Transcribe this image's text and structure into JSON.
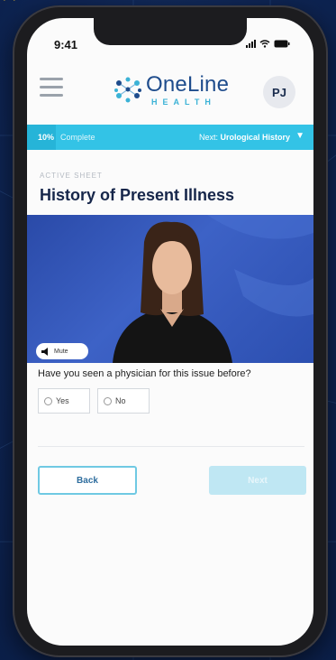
{
  "status_bar": {
    "time": "9:41"
  },
  "header": {
    "logo_name": "OneLine",
    "logo_sub": "HEALTH",
    "avatar_initials": "PJ"
  },
  "progress": {
    "percent_label": "10%",
    "label": "Complete",
    "fraction": 0.1,
    "next_prefix": "Next:",
    "next_section": "Urological History"
  },
  "sheet": {
    "tag": "ACTIVE SHEET",
    "title": "History of Present Illness"
  },
  "video": {
    "mute_label": "Mute"
  },
  "question": {
    "text": "Have you seen a physician for this issue before?",
    "options": [
      {
        "label": "Yes"
      },
      {
        "label": "No"
      }
    ]
  },
  "buttons": {
    "back": "Back",
    "next": "Next"
  },
  "colors": {
    "brand_blue": "#1e4c8c",
    "accent_cyan": "#33c3e6",
    "quote_gold": "#f2c230"
  }
}
